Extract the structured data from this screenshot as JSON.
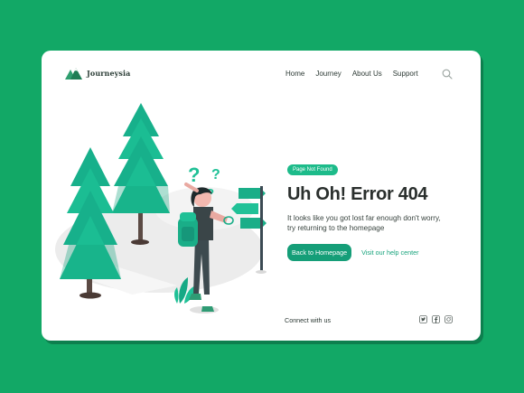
{
  "brand": {
    "name": "Journeysia",
    "logo_icon": "mountain-logo"
  },
  "nav": {
    "items": [
      "Home",
      "Journey",
      "About Us",
      "Support"
    ],
    "search_icon": "search-icon"
  },
  "error": {
    "badge": "Page Not Found",
    "title": "Uh Oh! Error 404",
    "description": "It looks like you got lost far enough don't worry, try returning to the homepage",
    "primary_button": "Back to Homepage",
    "help_link": "Visit our help center"
  },
  "footer": {
    "connect_label": "Connect with us",
    "social_icons": [
      "twitter-icon",
      "facebook-icon",
      "instagram-icon"
    ]
  },
  "colors": {
    "background": "#12a866",
    "accent": "#1dbb8a",
    "button": "#159e78",
    "text": "#2a2f2d"
  }
}
